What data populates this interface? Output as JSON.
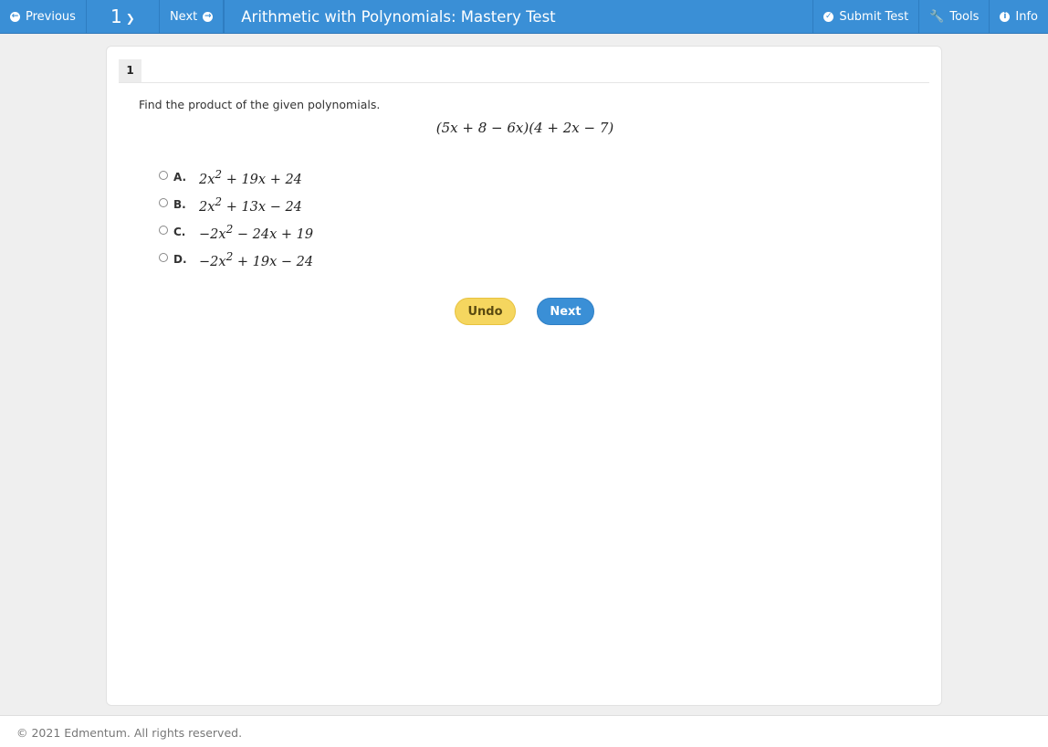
{
  "toolbar": {
    "previous_label": "Previous",
    "question_number": "1",
    "next_label": "Next",
    "title": "Arithmetic with Polynomials: Mastery Test",
    "submit_label": "Submit Test",
    "tools_label": "Tools",
    "info_label": "Info"
  },
  "question": {
    "tab_number": "1",
    "prompt": "Find the product of the given polynomials.",
    "expression": "(5x + 8 − 6x)(4 + 2x − 7)",
    "choices": [
      {
        "letter": "A.",
        "pre": "2x",
        "sup": "2",
        "post": " + 19x + 24"
      },
      {
        "letter": "B.",
        "pre": "2x",
        "sup": "2",
        "post": " + 13x − 24"
      },
      {
        "letter": "C.",
        "pre": "−2x",
        "sup": "2",
        "post": " − 24x + 19"
      },
      {
        "letter": "D.",
        "pre": "−2x",
        "sup": "2",
        "post": " + 19x − 24"
      }
    ]
  },
  "actions": {
    "undo_label": "Undo",
    "next_label": "Next"
  },
  "footer": {
    "copyright": "© 2021 Edmentum. All rights reserved."
  },
  "colors": {
    "toolbar": "#3a8fd6",
    "undo": "#f5d65f",
    "next": "#3a8fd6"
  }
}
